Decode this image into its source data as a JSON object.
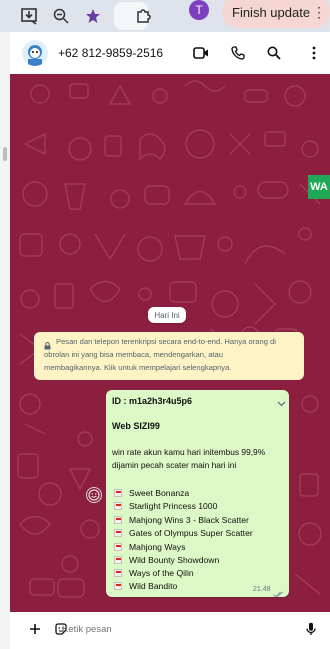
{
  "browser": {
    "profile_initial": "T",
    "finish_update_label": "Finish update",
    "menu_glyph": "⋮"
  },
  "header": {
    "phone": "+62 812-9859-2516",
    "icons": [
      "video-call-icon",
      "voice-call-icon",
      "search-icon",
      "more-options-icon"
    ]
  },
  "chat": {
    "side_badge": "WA",
    "date_chip": "Hari Ini",
    "encryption_notice": {
      "line1": "Pesan dan telepon terenkripsi secara end-to-end. Hanya orang di",
      "line2": "obrolan ini yang bisa membaca, mendengarkan, atau",
      "line3": "membagikannya. Klik untuk mempelajari selengkapnya."
    },
    "message": {
      "id_line": "ID : m1a2h3r4u5p6",
      "title": "Web SIZI99",
      "body_line1": "win rate akun kamu hari initembus 99,9%",
      "body_line2": "dijamin pecah scater main hari ini",
      "games": [
        "Sweet Bonanza",
        "Starlight Princess 1000",
        "Mahjong Wins 3 - Black Scatter",
        "Gates of Olympus Super Scatter",
        "Mahjong Ways",
        "Wild Bounty Showdown",
        "Ways of the Qilin",
        "Wild Bandito"
      ],
      "time": "21.48"
    }
  },
  "composer": {
    "placeholder": "Ketik pesan"
  },
  "colors": {
    "chat_background": "#8c1f40",
    "outgoing_bubble": "#dcf8c6",
    "notice_background": "#fdf3c5",
    "whatsapp_green": "#1fa855"
  }
}
